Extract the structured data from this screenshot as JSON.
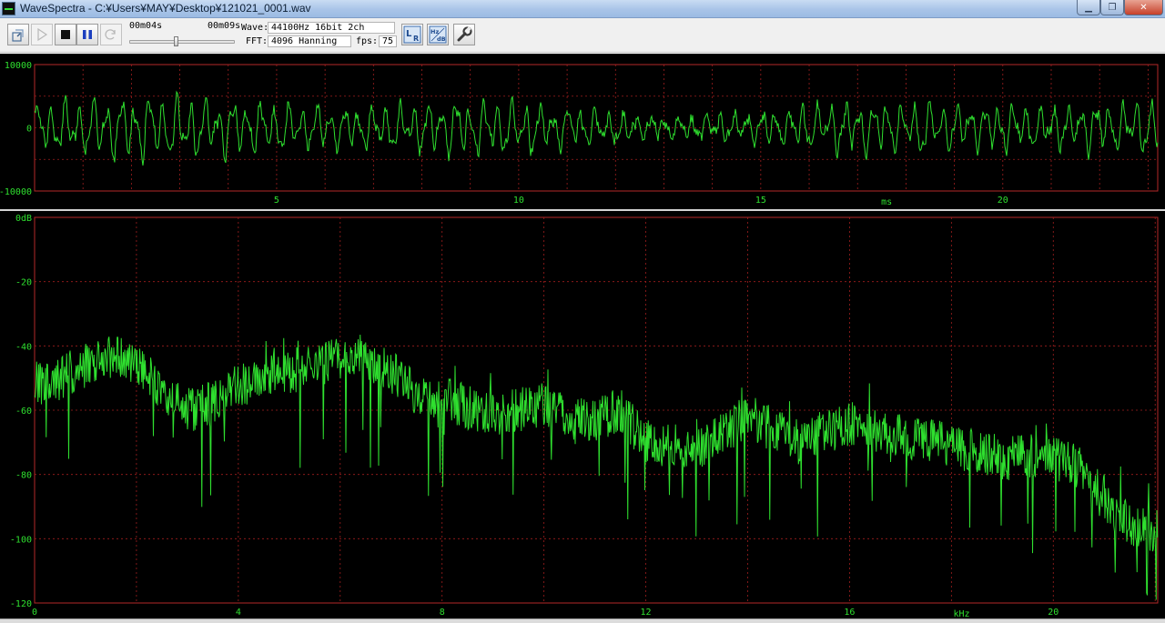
{
  "window": {
    "title": "WaveSpectra - C:¥Users¥MAY¥Desktop¥121021_0001.wav",
    "icons": {
      "app": "wavespectra-app-icon",
      "minimize": "minimize-icon",
      "maximize": "maximize-icon",
      "close": "close-icon"
    },
    "minimize_glyph": "▁",
    "maximize_glyph": "❐",
    "close_glyph": "✕"
  },
  "toolbar": {
    "buttons": [
      {
        "name": "record-source-button",
        "icon": "record-source-icon",
        "enabled": true
      },
      {
        "name": "play-button",
        "icon": "play-icon",
        "enabled": false
      },
      {
        "name": "stop-button",
        "icon": "stop-icon",
        "enabled": true
      },
      {
        "name": "pause-button",
        "icon": "pause-icon",
        "enabled": true
      },
      {
        "name": "loop-button",
        "icon": "loop-icon",
        "enabled": false
      },
      {
        "name": "channel-lr-button",
        "icon": "channel-lr-icon",
        "enabled": true
      },
      {
        "name": "hz-db-button",
        "icon": "hz-db-icon",
        "enabled": true
      },
      {
        "name": "settings-button",
        "icon": "wrench-icon",
        "enabled": true
      }
    ],
    "position_time": "00m04s",
    "total_time": "00m09s",
    "progress_fraction": 0.44,
    "wave_label": "Wave:",
    "wave_value": "44100Hz 16bit 2ch",
    "fft_label": "FFT:",
    "fft_value": "4096 Hanning",
    "fps_label": "fps:",
    "fps_value": "75"
  },
  "colors": {
    "trace": "#2fe02f",
    "grid": "#a01e1e",
    "frame": "#b42828",
    "text": "#2fe02f",
    "background": "#000000"
  },
  "waveform": {
    "y_labels": [
      "10000",
      "0",
      "-10000"
    ],
    "y_values": [
      10000,
      0,
      -10000
    ],
    "x_ticks": [
      "5",
      "10",
      "15",
      "20"
    ],
    "x_tick_values": [
      5,
      10,
      15,
      20
    ],
    "x_unit": "ms",
    "x_range": [
      0,
      23.2
    ],
    "y_range": [
      -10000,
      10000
    ]
  },
  "spectrum": {
    "y_labels": [
      "0dB",
      "-20",
      "-40",
      "-60",
      "-80",
      "-100",
      "-120"
    ],
    "y_values": [
      0,
      -20,
      -40,
      -60,
      -80,
      -100,
      -120
    ],
    "x_ticks": [
      "0",
      "4",
      "8",
      "12",
      "16",
      "20"
    ],
    "x_tick_values": [
      0,
      4,
      8,
      12,
      16,
      20
    ],
    "x_unit": "kHz",
    "x_range": [
      0,
      22.05
    ],
    "y_range": [
      -120,
      0
    ],
    "envelope": {
      "khz": [
        0,
        0.5,
        1,
        1.5,
        2,
        2.5,
        3,
        3.5,
        4,
        5,
        6,
        6.5,
        7,
        7.5,
        8,
        9,
        10,
        10.5,
        11,
        11.5,
        12,
        13,
        14,
        15,
        16,
        17,
        18,
        19,
        20,
        20.5,
        21,
        21.5,
        22.05
      ],
      "db": [
        -52,
        -50,
        -46,
        -44,
        -45,
        -55,
        -60,
        -58,
        -52,
        -48,
        -44,
        -43,
        -48,
        -55,
        -56,
        -62,
        -58,
        -62,
        -64,
        -60,
        -70,
        -72,
        -62,
        -70,
        -64,
        -68,
        -71,
        -75,
        -74,
        -78,
        -88,
        -95,
        -98
      ]
    }
  }
}
